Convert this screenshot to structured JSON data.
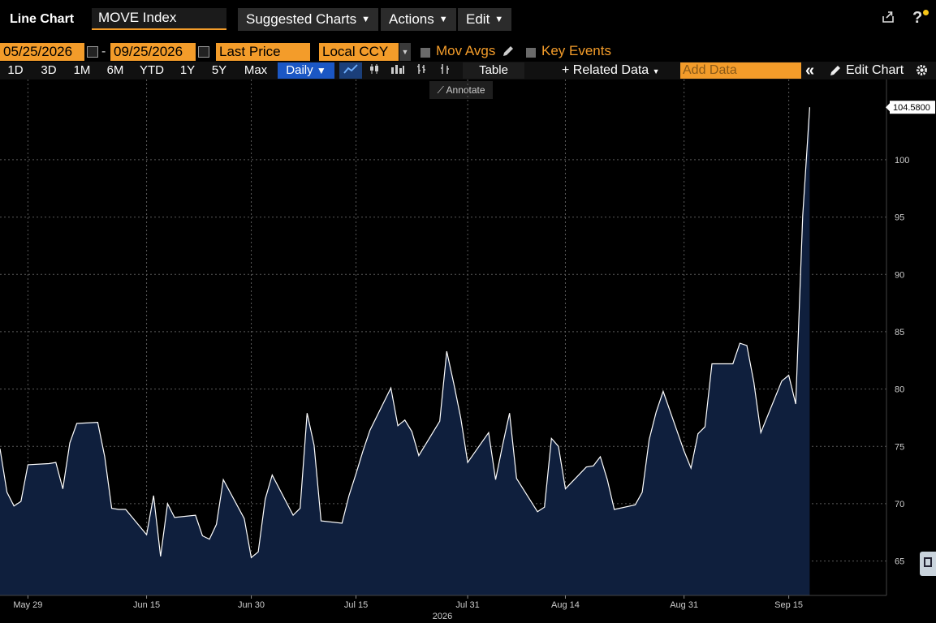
{
  "header": {
    "title": "Line Chart",
    "ticker": "MOVE Index",
    "menus": [
      "Suggested Charts",
      "Actions",
      "Edit"
    ],
    "share_icon": "share-icon",
    "help_label": "?"
  },
  "controls": {
    "start_date": "05/25/2026",
    "date_separator": "-",
    "end_date": "09/25/2026",
    "field": "Last Price",
    "currency": "Local CCY",
    "mov_avgs": "Mov Avgs",
    "key_events": "Key Events",
    "periods": [
      "1D",
      "3D",
      "1M",
      "6M",
      "YTD",
      "1Y",
      "5Y",
      "Max"
    ],
    "frequency": "Daily",
    "table_label": "Table",
    "related_data": "+ Related Data",
    "add_data_placeholder": "Add Data",
    "collapse_label": "«",
    "edit_chart": "Edit Chart",
    "annotate": "Annotate"
  },
  "colors": {
    "accent": "#f39c2a",
    "daily_button": "#1b57c4",
    "area_fill": "#0f1f3d",
    "line": "#ffffff",
    "background": "#000000"
  },
  "chart_data": {
    "type": "area",
    "title": "",
    "xlabel": "2026",
    "ylabel": "",
    "x_tick_labels": [
      "May 29",
      "Jun 15",
      "Jun 30",
      "Jul 15",
      "Jul 31",
      "Aug 14",
      "Aug 31",
      "Sep 15"
    ],
    "y_tick_labels": [
      "65",
      "70",
      "75",
      "80",
      "85",
      "90",
      "95",
      "100"
    ],
    "ylim": [
      62,
      107
    ],
    "grid": true,
    "last_value_label": "104.5800",
    "dates": [
      "2026-05-25",
      "2026-05-26",
      "2026-05-27",
      "2026-05-28",
      "2026-05-29",
      "2026-06-01",
      "2026-06-02",
      "2026-06-03",
      "2026-06-04",
      "2026-06-05",
      "2026-06-08",
      "2026-06-09",
      "2026-06-10",
      "2026-06-11",
      "2026-06-12",
      "2026-06-15",
      "2026-06-16",
      "2026-06-17",
      "2026-06-18",
      "2026-06-19",
      "2026-06-22",
      "2026-06-23",
      "2026-06-24",
      "2026-06-25",
      "2026-06-26",
      "2026-06-29",
      "2026-06-30",
      "2026-07-01",
      "2026-07-02",
      "2026-07-03",
      "2026-07-06",
      "2026-07-07",
      "2026-07-08",
      "2026-07-09",
      "2026-07-10",
      "2026-07-13",
      "2026-07-14",
      "2026-07-15",
      "2026-07-16",
      "2026-07-17",
      "2026-07-20",
      "2026-07-21",
      "2026-07-22",
      "2026-07-23",
      "2026-07-24",
      "2026-07-27",
      "2026-07-28",
      "2026-07-29",
      "2026-07-30",
      "2026-07-31",
      "2026-08-03",
      "2026-08-04",
      "2026-08-05",
      "2026-08-06",
      "2026-08-07",
      "2026-08-10",
      "2026-08-11",
      "2026-08-12",
      "2026-08-13",
      "2026-08-14",
      "2026-08-17",
      "2026-08-18",
      "2026-08-19",
      "2026-08-20",
      "2026-08-21",
      "2026-08-24",
      "2026-08-25",
      "2026-08-26",
      "2026-08-27",
      "2026-08-28",
      "2026-08-31",
      "2026-09-01",
      "2026-09-02",
      "2026-09-03",
      "2026-09-04",
      "2026-09-07",
      "2026-09-08",
      "2026-09-09",
      "2026-09-10",
      "2026-09-11",
      "2026-09-14",
      "2026-09-15",
      "2026-09-16",
      "2026-09-17",
      "2026-09-18",
      "2026-09-21",
      "2026-09-22",
      "2026-09-23",
      "2026-09-24",
      "2026-09-25"
    ],
    "values": [
      74.8,
      71.0,
      69.8,
      70.2,
      73.4,
      73.5,
      73.6,
      71.3,
      75.3,
      77.0,
      77.1,
      74.1,
      69.6,
      69.5,
      69.5,
      67.3,
      70.7,
      65.4,
      70.0,
      68.8,
      69.0,
      67.2,
      66.9,
      68.2,
      72.1,
      68.7,
      65.3,
      65.8,
      70.4,
      72.5,
      69.0,
      69.6,
      77.9,
      75.1,
      68.5,
      68.3,
      70.7,
      72.6,
      74.6,
      76.4,
      80.1,
      76.8,
      77.3,
      76.3,
      74.2,
      77.2,
      83.3,
      80.5,
      77.5,
      73.6,
      76.2,
      72.1,
      75.1,
      77.9,
      72.2,
      69.3,
      69.7,
      75.7,
      75.0,
      71.3,
      73.2,
      73.3,
      74.1,
      72.1,
      69.5,
      69.9,
      71.0,
      75.6,
      78.0,
      79.8,
      74.6,
      73.1,
      76.1,
      76.7,
      82.2,
      82.2,
      84.0,
      83.8,
      80.6,
      76.2,
      80.7,
      81.2,
      78.7,
      95.1,
      104.58
    ]
  }
}
